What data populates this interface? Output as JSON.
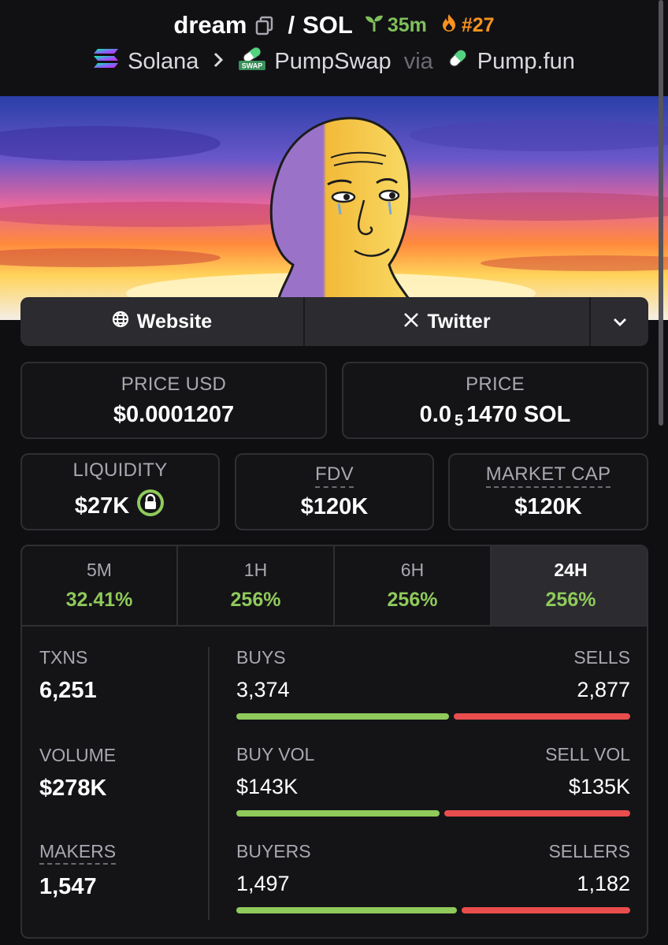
{
  "header": {
    "token": "dream",
    "slash": "/",
    "quote": "SOL",
    "age": "35m",
    "rank": "#27"
  },
  "breadcrumb": {
    "chain": "Solana",
    "dex": "PumpSwap",
    "via": "via",
    "launchpad": "Pump.fun",
    "swap_badge": "SWAP"
  },
  "links": {
    "website": "Website",
    "twitter": "Twitter"
  },
  "price": {
    "usd_label": "PRICE USD",
    "usd_value": "$0.0001207",
    "native_label": "PRICE",
    "native_prefix": "0.0",
    "native_zeros": "5",
    "native_rest": "1470 SOL"
  },
  "metrics": {
    "liquidity_label": "LIQUIDITY",
    "liquidity_value": "$27K",
    "fdv_label": "FDV",
    "fdv_value": "$120K",
    "mcap_label": "MARKET CAP",
    "mcap_value": "$120K"
  },
  "timeframes": [
    {
      "label": "5M",
      "value": "32.41%"
    },
    {
      "label": "1H",
      "value": "256%"
    },
    {
      "label": "6H",
      "value": "256%"
    },
    {
      "label": "24H",
      "value": "256%"
    }
  ],
  "stats": {
    "txns_label": "TXNS",
    "txns_value": "6,251",
    "volume_label": "VOLUME",
    "volume_value": "$278K",
    "makers_label": "MAKERS",
    "makers_value": "1,547",
    "buys_label": "BUYS",
    "buys_value": "3,374",
    "sells_label": "SELLS",
    "sells_value": "2,877",
    "buyvol_label": "BUY VOL",
    "buyvol_value": "$143K",
    "sellvol_label": "SELL VOL",
    "sellvol_value": "$135K",
    "buyers_label": "BUYERS",
    "buyers_value": "1,497",
    "sellers_label": "SELLERS",
    "sellers_value": "1,182",
    "buys_ratio": 0.54,
    "buyvol_ratio": 0.515,
    "buyers_ratio": 0.559
  },
  "colors": {
    "green": "#8fca5b",
    "red": "#ea4d4d",
    "orange": "#f7931e",
    "card_border": "#2e2e33"
  }
}
